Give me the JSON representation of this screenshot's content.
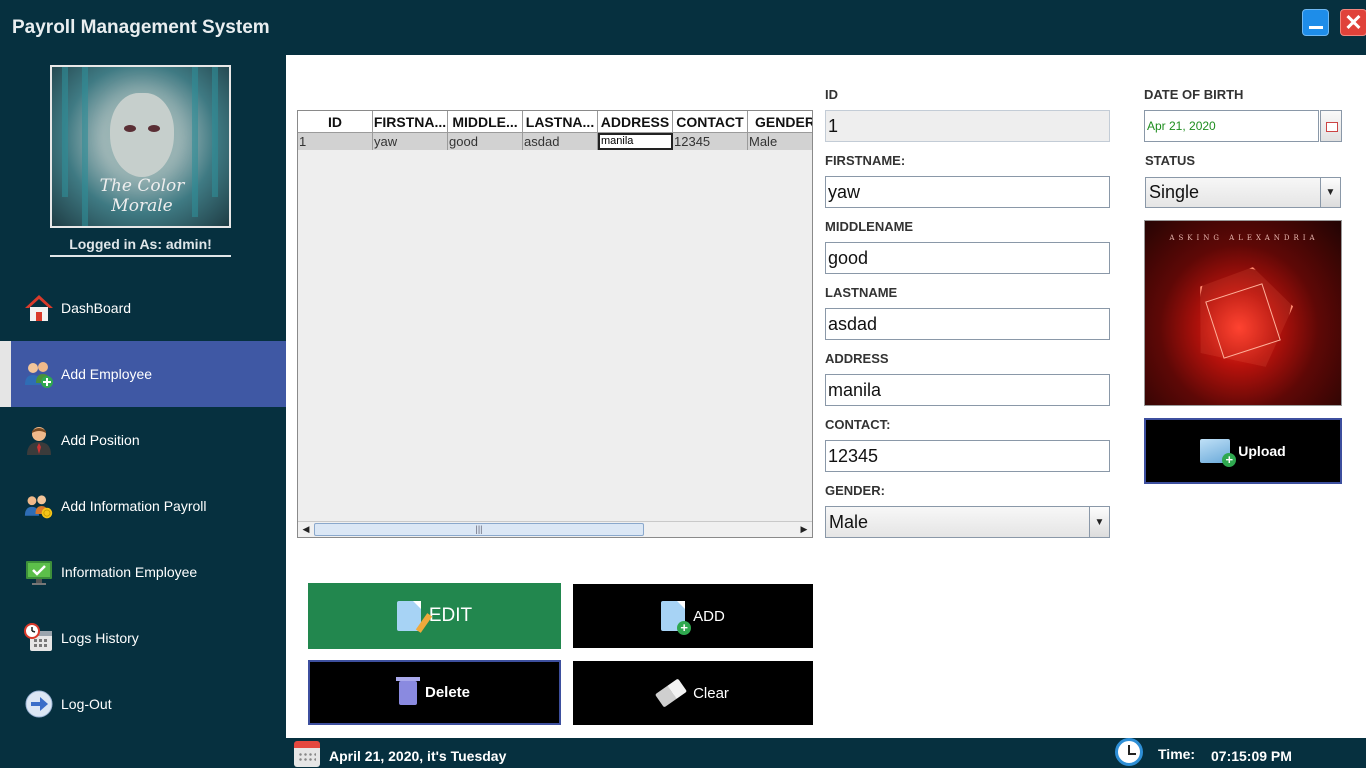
{
  "app": {
    "title": "Payroll Management System"
  },
  "sidebar": {
    "logged_in": "Logged in As: admin!",
    "avatar_signature": "The Color Morale",
    "items": [
      {
        "label": "DashBoard",
        "icon": "house-icon"
      },
      {
        "label": "Add Employee",
        "icon": "add-employee-icon",
        "active": true
      },
      {
        "label": "Add Position",
        "icon": "person-tie-icon"
      },
      {
        "label": "Add Information Payroll",
        "icon": "payroll-people-icon"
      },
      {
        "label": "Information Employee",
        "icon": "monitor-check-icon"
      },
      {
        "label": "Logs History",
        "icon": "calendar-clock-icon"
      },
      {
        "label": "Log-Out",
        "icon": "arrow-right-circle-icon"
      }
    ]
  },
  "table": {
    "columns": [
      "ID",
      "FIRSTNA...",
      "MIDDLE...",
      "LASTNA...",
      "ADDRESS",
      "CONTACT",
      "GENDER"
    ],
    "rows": [
      [
        "1",
        "yaw",
        "good",
        "asdad",
        "manila",
        "12345",
        "Male"
      ]
    ]
  },
  "buttons": {
    "edit": "EDIT",
    "add": "ADD",
    "delete": "Delete",
    "clear": "Clear",
    "upload": "Upload"
  },
  "form": {
    "id_label": "ID",
    "id_value": "1",
    "firstname_label": "FIRSTNAME:",
    "firstname_value": "yaw",
    "middlename_label": "MIDDLENAME",
    "middlename_value": "good",
    "lastname_label": "LASTNAME",
    "lastname_value": "asdad",
    "address_label": "ADDRESS",
    "address_value": "manila",
    "contact_label": "CONTACT:",
    "contact_value": "12345",
    "gender_label": "GENDER:",
    "gender_value": "Male",
    "dob_label": "DATE OF BIRTH",
    "dob_value": "Apr 21, 2020",
    "status_label": "STATUS",
    "status_value": "Single",
    "photo_caption": "ASKING ALEXANDRIA"
  },
  "footer": {
    "date_text": "April 21, 2020, it's Tuesday",
    "time_label": "Time:",
    "time_value": "07:15:09 PM"
  },
  "colors": {
    "background": "#06303f",
    "active_nav": "#3f58a4",
    "edit_button": "#22874e",
    "close_button": "#e0423a",
    "minimize_button": "#1e8de9"
  }
}
